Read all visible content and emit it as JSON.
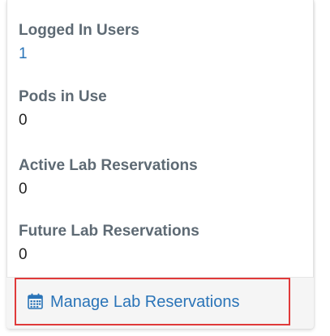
{
  "stats": [
    {
      "label": "Logged In Users",
      "value": "1"
    },
    {
      "label": "Pods in Use",
      "value": "0"
    },
    {
      "label": "Active Lab Reservations",
      "value": "0"
    },
    {
      "label": "Future Lab Reservations",
      "value": "0"
    }
  ],
  "footer": {
    "manage_label": "Manage Lab Reservations",
    "icon": "calendar-icon"
  },
  "colors": {
    "link": "#2a74b8",
    "label": "#5e6a74",
    "highlight": "#e03a3a"
  }
}
